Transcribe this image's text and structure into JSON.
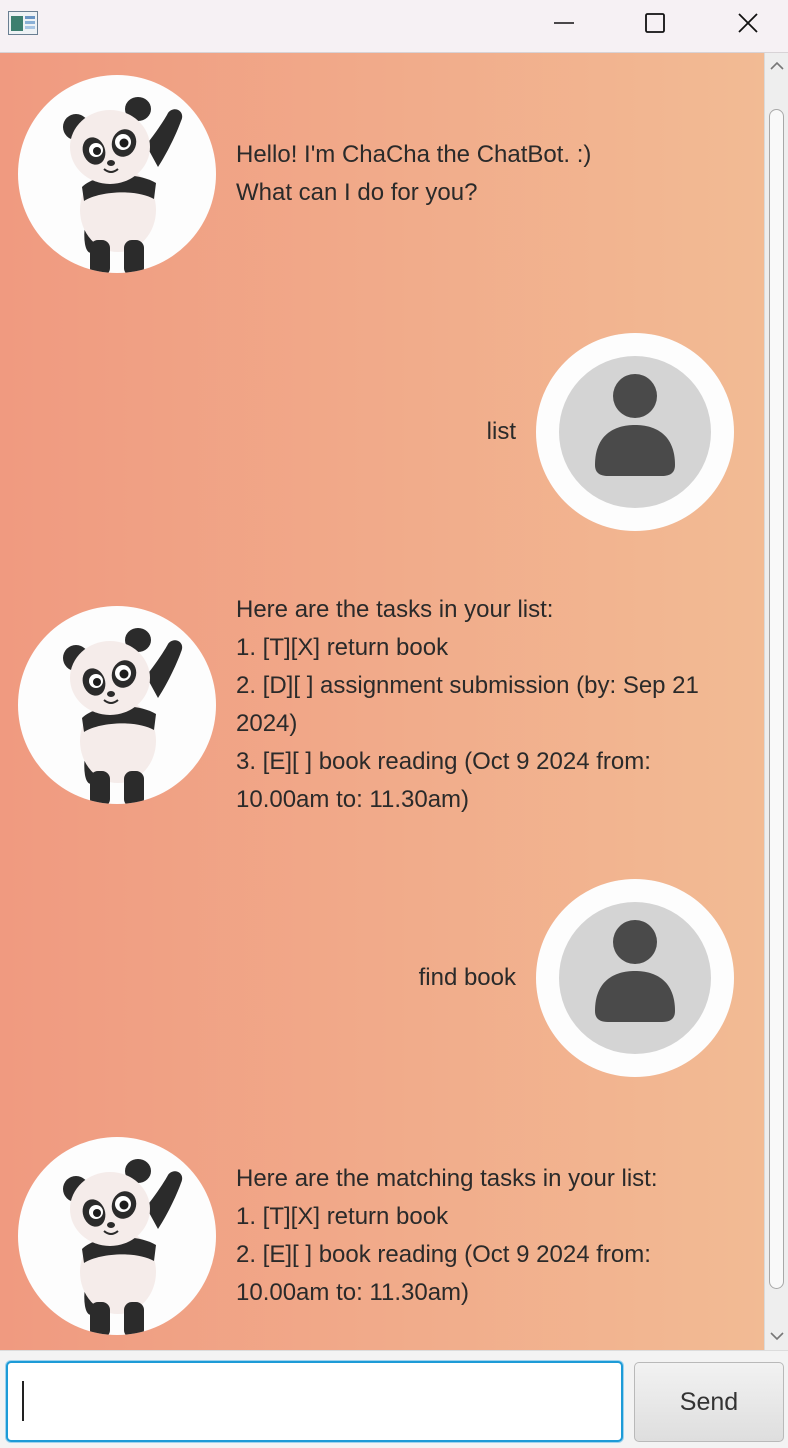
{
  "window": {
    "icons": {
      "app": "app-icon",
      "minimize": "minimize-icon",
      "maximize": "maximize-icon",
      "close": "close-icon"
    }
  },
  "messages": [
    {
      "sender": "bot",
      "lines": [
        "Hello! I'm ChaCha the ChatBot. :)",
        "What can I do for you?"
      ]
    },
    {
      "sender": "user",
      "lines": [
        "list"
      ]
    },
    {
      "sender": "bot",
      "lines": [
        "Here are the tasks in your list:",
        "1. [T][X] return book",
        "2. [D][ ] assignment submission (by: Sep 21",
        "2024)",
        "3. [E][ ] book reading (Oct 9 2024 from:",
        "10.00am to: 11.30am)"
      ]
    },
    {
      "sender": "user",
      "lines": [
        "find book"
      ]
    },
    {
      "sender": "bot",
      "lines": [
        "Here are the matching tasks in your list:",
        "1. [T][X] return book",
        "2. [E][ ] book reading (Oct 9 2024 from:",
        "10.00am to: 11.30am)"
      ]
    }
  ],
  "avatars": {
    "bot": "panda-avatar-icon",
    "user": "user-avatar-icon"
  },
  "input": {
    "value": "",
    "placeholder": ""
  },
  "send_button": {
    "label": "Send"
  },
  "colors": {
    "gradient_start": "#f09a80",
    "gradient_end": "#f2bb94",
    "input_focus": "#1d9bd7"
  }
}
